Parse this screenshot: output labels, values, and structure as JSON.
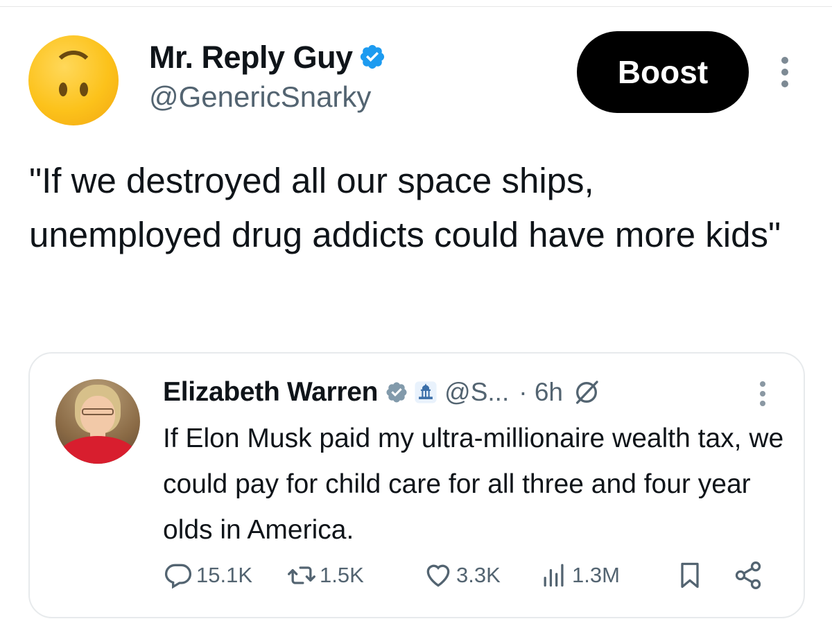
{
  "post": {
    "display_name": "Mr. Reply Guy",
    "handle": "@GenericSnarky",
    "avatar_icon": "upside-down-face-emoji",
    "verified_icon": "verified-badge-icon",
    "boost_label": "Boost",
    "text": "\"If we destroyed all our space ships, unemployed drug addicts could have more kids\""
  },
  "quoted": {
    "display_name": "Elizabeth Warren",
    "handle": "@S...",
    "time": "· 6h",
    "text": "If Elon Musk paid my ultra-millionaire wealth tax, we could pay for child care for all three and four year olds in America.",
    "stats": {
      "replies": "15.1K",
      "reposts": "1.5K",
      "likes": "3.3K",
      "views": "1.3M"
    }
  },
  "colors": {
    "boost_bg": "#000000",
    "verified_blue": "#1d9bf0",
    "muted_text": "#536471"
  }
}
